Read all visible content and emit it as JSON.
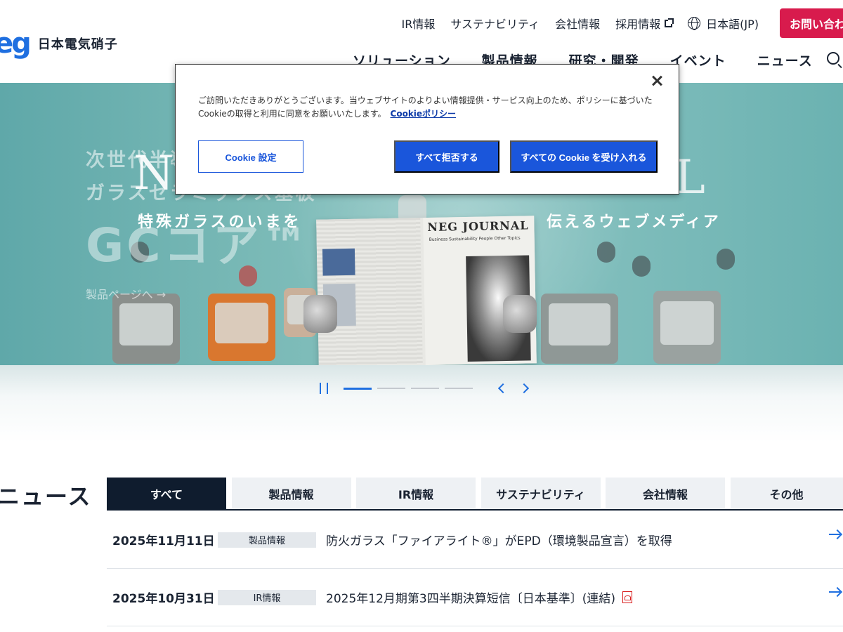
{
  "header": {
    "logo_mark": "eg",
    "logo_name": "日本電気硝子",
    "util_nav": [
      "IR情報",
      "サステナビリティ",
      "会社情報",
      "採用情報"
    ],
    "language": "日本語(JP)",
    "contact_button": "お問い合わせ",
    "main_nav": [
      "ソリューション",
      "製品情報",
      "研究・開発",
      "イベント",
      "ニュース"
    ]
  },
  "hero": {
    "left_line1": "次世代半導体",
    "left_line2": "ガラスセラミックス基板",
    "left_big": "GCコア™",
    "left_link": "製品ページへ →",
    "tag_left": "特殊ガラスのいまを",
    "tag_right": "伝えるウェブメディア",
    "newspaper_title": "NEG JOURNAL",
    "newspaper_sub": "Business  Sustainability  People  Other Topics",
    "slides_total": 4,
    "active_slide": 1
  },
  "cookie": {
    "text": "ご訪問いただきありがとうございます。当ウェブサイトのよりよい情報提供・サービス向上のため、ポリシーに基づいたCookieの取得と利用に同意をお願いいたします。",
    "policy_link": "Cookieポリシー",
    "settings_button": "Cookie 設定",
    "reject_button": "すべて拒否する",
    "accept_button": "すべての Cookie を受け入れる"
  },
  "news": {
    "heading": "ニュース",
    "tabs": [
      "すべて",
      "製品情報",
      "IR情報",
      "サステナビリティ",
      "会社情報",
      "その他"
    ],
    "active_tab": "すべて",
    "items": [
      {
        "date": "2025年11月11日",
        "category": "製品情報",
        "title": "防火ガラス「ファイアライト®」がEPD（環境製品宣言）を取得",
        "pdf": false
      },
      {
        "date": "2025年10月31日",
        "category": "IR情報",
        "title": "2025年12月期第3四半期決算短信〔日本基準〕(連結)",
        "pdf": true
      }
    ]
  },
  "colors": {
    "brand_blue": "#1f6fe0",
    "contact_red": "#d81b4d",
    "cookie_button_blue": "#1a56db",
    "tab_active": "#0f1c2e"
  }
}
